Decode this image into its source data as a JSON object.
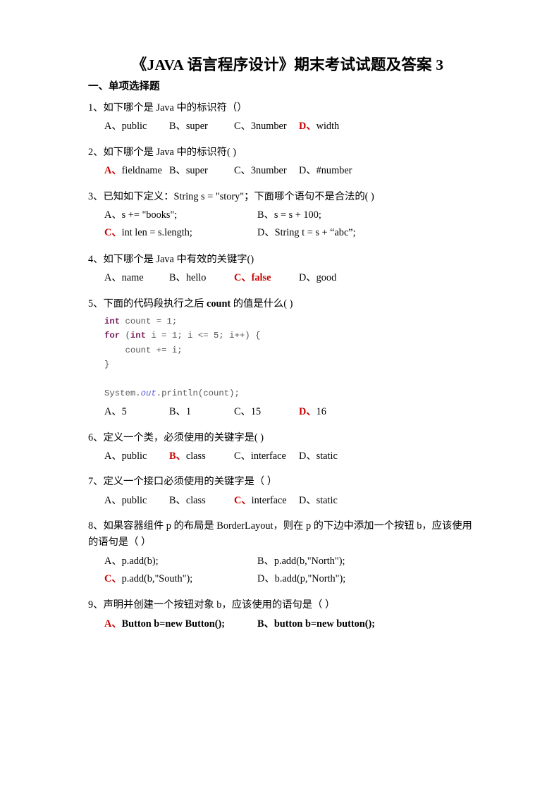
{
  "document": {
    "title": "《JAVA 语言程序设计》期末考试试题及答案 3",
    "section_heading": "一、单项选择题",
    "accent_red": "#cc0000",
    "code_keyword_color": "#7a1f5e",
    "code_field_color": "#5b5bd6"
  },
  "questions": [
    {
      "id": "q1",
      "stem": "1、如下哪个是 Java 中的标识符（）",
      "layout": "row4",
      "options": [
        {
          "label": "A、",
          "text": "public",
          "answer": false
        },
        {
          "label": "B、",
          "text": "super",
          "answer": false
        },
        {
          "label": "C、",
          "text": "3number",
          "answer": false
        },
        {
          "label": "D、",
          "text": "width",
          "answer": true
        }
      ]
    },
    {
      "id": "q2",
      "stem": "2、如下哪个是 Java 中的标识符( )",
      "layout": "row4",
      "options": [
        {
          "label": "A、",
          "text": "fieldname",
          "answer": true
        },
        {
          "label": "B、",
          "text": "super",
          "answer": false
        },
        {
          "label": "C、",
          "text": "3number",
          "answer": false
        },
        {
          "label": "D、",
          "text": "#number",
          "answer": false
        }
      ]
    },
    {
      "id": "q3",
      "stem": "3、已知如下定义：String s = \"story\"；下面哪个语句不是合法的( )",
      "layout": "grid2",
      "options": [
        {
          "label": "A、",
          "text": "s += \"books\";",
          "answer": false
        },
        {
          "label": "B、",
          "text": "s = s + 100;",
          "answer": false
        },
        {
          "label": "C、",
          "text": "int len = s.length;",
          "answer": true
        },
        {
          "label": "D、",
          "text": "String t = s + “abc”;",
          "answer": false
        }
      ]
    },
    {
      "id": "q4",
      "stem": "4、如下哪个是 Java 中有效的关键字()",
      "layout": "row4",
      "options": [
        {
          "label": "A、",
          "text": "name",
          "answer": false
        },
        {
          "label": "B、",
          "text": "hello",
          "answer": false
        },
        {
          "label": "C、",
          "text": "false",
          "answer": true,
          "answer_text": true
        },
        {
          "label": "D、",
          "text": "good",
          "answer": false
        }
      ]
    },
    {
      "id": "q5",
      "stem_parts": [
        {
          "text": "5、下面的代码段执行之后 ",
          "bold": false
        },
        {
          "text": "count",
          "bold": true
        },
        {
          "text": " 的值是什么(          )",
          "bold": false
        }
      ],
      "code_lines": [
        [
          {
            "t": "int",
            "c": "kw"
          },
          {
            "t": " count = 1;",
            "c": ""
          }
        ],
        [
          {
            "t": "for",
            "c": "kw"
          },
          {
            "t": " (",
            "c": ""
          },
          {
            "t": "int",
            "c": "kw"
          },
          {
            "t": " i = 1; i <= 5; i++) {",
            "c": ""
          }
        ],
        [
          {
            "t": "    count += i;",
            "c": ""
          }
        ],
        [
          {
            "t": "}",
            "c": ""
          }
        ],
        [
          {
            "t": "",
            "c": ""
          }
        ],
        [
          {
            "t": "System.",
            "c": ""
          },
          {
            "t": "out",
            "c": "fld"
          },
          {
            "t": ".println(count);",
            "c": ""
          }
        ]
      ],
      "layout": "row4",
      "options": [
        {
          "label": "A、",
          "text": "5",
          "answer": false
        },
        {
          "label": "B、",
          "text": "1",
          "answer": false
        },
        {
          "label": "C、",
          "text": "15",
          "answer": false
        },
        {
          "label": "D、",
          "text": "16",
          "answer": true
        }
      ]
    },
    {
      "id": "q6",
      "stem": "6、定义一个类，必须使用的关键字是(  )",
      "layout": "row4",
      "options": [
        {
          "label": "A、",
          "text": "public",
          "answer": false
        },
        {
          "label": "B、",
          "text": "class",
          "answer": true
        },
        {
          "label": "C、",
          "text": "interface",
          "answer": false
        },
        {
          "label": "D、",
          "text": "static",
          "answer": false
        }
      ]
    },
    {
      "id": "q7",
      "stem": "7、定义一个接口必须使用的关键字是（      ）",
      "layout": "row4",
      "options": [
        {
          "label": "A、",
          "text": "public",
          "answer": false
        },
        {
          "label": "B、",
          "text": "class",
          "answer": false
        },
        {
          "label": "C、",
          "text": "interface",
          "answer": true
        },
        {
          "label": "D、",
          "text": "static",
          "answer": false
        }
      ]
    },
    {
      "id": "q8",
      "stem": "8、如果容器组件 p 的布局是 BorderLayout，则在 p 的下边中添加一个按钮 b，应该使用的语句是（  ）",
      "layout": "grid2",
      "options": [
        {
          "label": "A、",
          "text": "p.add(b);",
          "answer": false
        },
        {
          "label": "B、",
          "text": "p.add(b,\"North\");",
          "answer": false
        },
        {
          "label": "C、",
          "text": "p.add(b,\"South\");",
          "answer": true
        },
        {
          "label": "D、",
          "text": "b.add(p,\"North\");",
          "answer": false
        }
      ]
    },
    {
      "id": "q9",
      "stem": "9、声明并创建一个按钮对象 b，应该使用的语句是（      ）",
      "layout": "grid2",
      "bold_options": true,
      "options": [
        {
          "label": "A、",
          "text": "Button b=new Button();",
          "answer": true
        },
        {
          "label": "B、",
          "text": "button b=new button();",
          "answer": false
        }
      ]
    }
  ]
}
